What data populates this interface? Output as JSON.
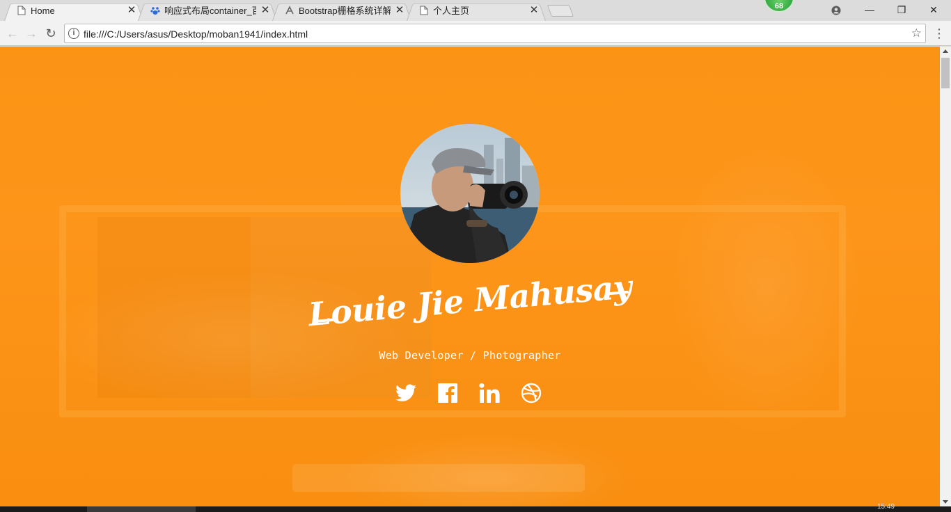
{
  "tabs": [
    {
      "title": "Home",
      "icon": "page-icon",
      "active": true
    },
    {
      "title": "响应式布局container_百",
      "icon": "baidu-paw-icon",
      "active": false
    },
    {
      "title": "Bootstrap栅格系统详解",
      "icon": "bootstrap-icon",
      "active": false
    },
    {
      "title": "个人主页",
      "icon": "page-icon",
      "active": false
    }
  ],
  "badge": {
    "count": "68",
    "color": "#2ea944"
  },
  "window_controls": {
    "minimize": "—",
    "restore": "❐",
    "close": "✕"
  },
  "toolbar": {
    "url": "file:///C:/Users/asus/Desktop/moban1941/index.html",
    "back_icon": "←",
    "forward_icon": "→",
    "reload_icon": "↻",
    "star_icon": "☆",
    "menu_icon": "⋮",
    "info_icon": "i"
  },
  "hero": {
    "name": "Louie Jie Mahusay",
    "subtitle": "Web Developer / Photographer",
    "background_color": "#fb9315",
    "socials": [
      "twitter-icon",
      "facebook-icon",
      "linkedin-icon",
      "dribbble-icon"
    ]
  },
  "taskbar": {
    "clock": "15:49"
  }
}
